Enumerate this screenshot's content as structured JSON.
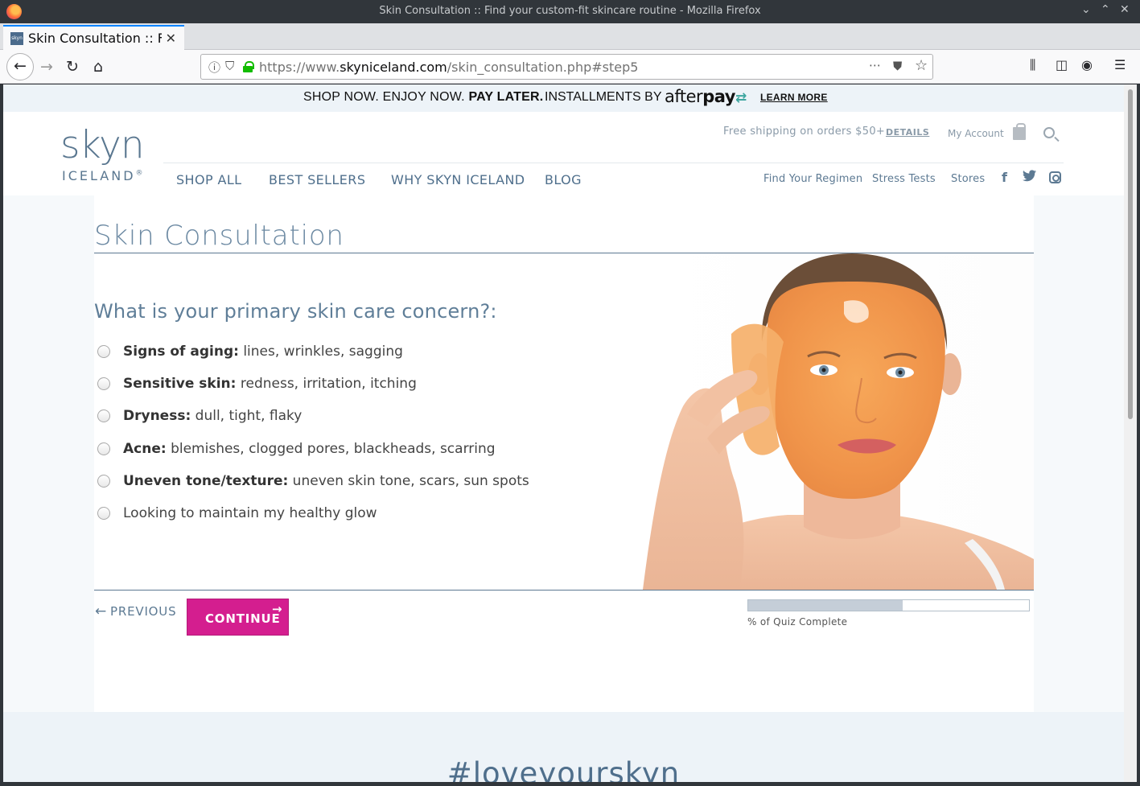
{
  "window": {
    "title": "Skin Consultation :: Find your custom-fit skincare routine - Mozilla Firefox",
    "tab_title": "Skin Consultation :: Find your custom-fit skincare routine",
    "favicon_text": "skyn",
    "url_prefix": "https://www.",
    "url_domain": "skyniceland.com",
    "url_path": "/skin_consultation.php#step5"
  },
  "promo": {
    "shop": "SHOP NOW. ENJOY NOW.",
    "pay_later": "PAY LATER.",
    "installments": "INSTALLMENTS BY",
    "afterpay_pre": "after",
    "afterpay_bold": "pay",
    "learn_more": "LEARN MORE"
  },
  "header": {
    "logo_main": "skyn",
    "logo_sub": "ICELAND",
    "free_shipping": "Free shipping on orders $50+",
    "details": "DETAILS",
    "my_account": "My Account",
    "nav": [
      "SHOP ALL",
      "BEST SELLERS",
      "WHY SKYN ICELAND",
      "BLOG"
    ],
    "subnav": [
      "Find Your Regimen",
      "Stress Tests",
      "Stores"
    ]
  },
  "quiz": {
    "title": "Skin Consultation",
    "question": "What is your primary skin care concern?:",
    "options": [
      {
        "bold": "Signs of aging:",
        "text": " lines, wrinkles, sagging"
      },
      {
        "bold": "Sensitive skin:",
        "text": " redness, irritation, itching"
      },
      {
        "bold": "Dryness:",
        "text": " dull, tight, flaky"
      },
      {
        "bold": "Acne:",
        "text": " blemishes, clogged pores, blackheads, scarring"
      },
      {
        "bold": "Uneven tone/texture:",
        "text": " uneven skin tone, scars, sun spots"
      },
      {
        "bold": "",
        "text": "Looking to maintain my healthy glow"
      }
    ],
    "previous": "PREVIOUS",
    "continue": "CONTINUE",
    "progress_fraction": 0.55,
    "progress_label": "% of Quiz Complete"
  },
  "footer": {
    "hashtag": "#loveyourskyn"
  },
  "colors": {
    "accent": "#d41e8f",
    "brand_blue": "#5a7790"
  }
}
